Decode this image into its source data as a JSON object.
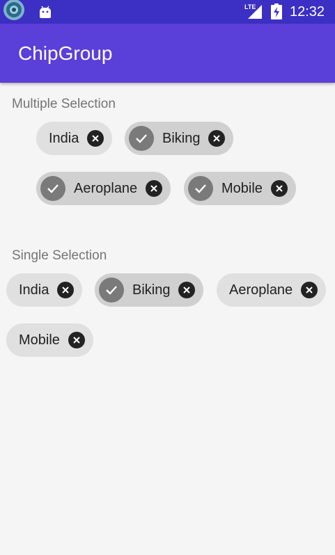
{
  "status_bar": {
    "network": "LTE",
    "time": "12:32"
  },
  "app_bar": {
    "title": "ChipGroup"
  },
  "multiple": {
    "label": "Multiple Selection",
    "chips": [
      {
        "label": "India",
        "checked": false
      },
      {
        "label": "Biking",
        "checked": true
      },
      {
        "label": "Aeroplane",
        "checked": true
      },
      {
        "label": "Mobile",
        "checked": true
      }
    ]
  },
  "single": {
    "label": "Single Selection",
    "chips": [
      {
        "label": "India",
        "checked": false
      },
      {
        "label": "Biking",
        "checked": true
      },
      {
        "label": "Aeroplane",
        "checked": false
      },
      {
        "label": "Mobile",
        "checked": false
      }
    ]
  },
  "colors": {
    "status_bar": "#3c2fc4",
    "app_bar": "#5b3fd9",
    "background": "#f5f5f5"
  }
}
